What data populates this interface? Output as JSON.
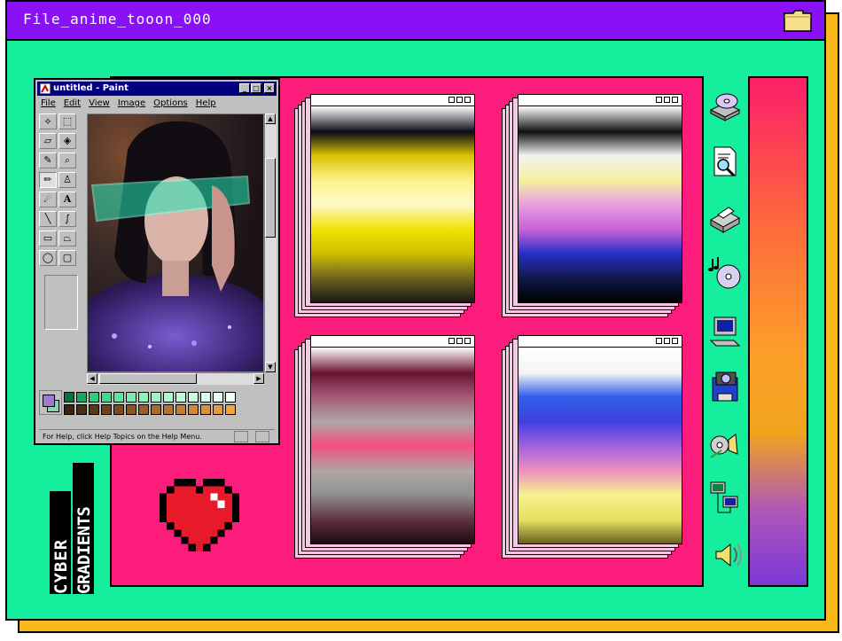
{
  "window": {
    "title": "File_anime_tooon_000",
    "folder_icon": "folder-icon"
  },
  "paint": {
    "title": "untitled - Paint",
    "menu": [
      "File",
      "Edit",
      "View",
      "Image",
      "Options",
      "Help"
    ],
    "status_text": "For Help, click Help Topics on the Help Menu.",
    "tools": [
      "free-select-icon",
      "rect-select-icon",
      "eraser-icon",
      "fill-icon",
      "picker-icon",
      "magnifier-icon",
      "pencil-icon",
      "brush-icon",
      "airbrush-icon",
      "text-icon",
      "line-icon",
      "curve-icon",
      "rectangle-icon",
      "polygon-icon",
      "ellipse-icon",
      "rounded-rect-icon"
    ],
    "palette_top": [
      "#0a6e3f",
      "#1aa860",
      "#2bc979",
      "#43d98c",
      "#5fe39f",
      "#7aebb0",
      "#90f0bd",
      "#a2f3c7",
      "#b1f6d0",
      "#bff8d8",
      "#cbfadf",
      "#d8fce7",
      "#e3fdee",
      "#eefef4"
    ],
    "palette_bottom": [
      "#3a2410",
      "#4a2e14",
      "#5a3818",
      "#6a421c",
      "#7a4c20",
      "#8a5624",
      "#986028",
      "#a66a2c",
      "#b47430",
      "#c27e34",
      "#ce8838",
      "#d8923c",
      "#e29c40",
      "#eca644"
    ]
  },
  "gradients": [
    {
      "stops": [
        "#ffffff",
        "#0c0a18",
        "#d7c200",
        "#fff38e",
        "#fff9c8",
        "#f0e200",
        "#cfc000",
        "#6c6020",
        "#1a1818"
      ]
    },
    {
      "stops": [
        "#ffffff",
        "#101010",
        "#f2f2f2",
        "#f4f0a0",
        "#e8a0e0",
        "#c860d8",
        "#2830c8",
        "#101848",
        "#000000"
      ]
    },
    {
      "stops": [
        "#ffffff",
        "#6a1232",
        "#a45a76",
        "#b0a6a6",
        "#f34d82",
        "#b0a6a6",
        "#909090",
        "#5e3240",
        "#1b0a12"
      ]
    },
    {
      "stops": [
        "#ffffff",
        "#f4f4f4",
        "#3060e8",
        "#4040e0",
        "#a060e0",
        "#f090c0",
        "#f6f090",
        "#e8e060",
        "#686020"
      ]
    }
  ],
  "colors": {
    "bg": "#15ee9c",
    "title": "#8811f5",
    "panel": "#fb1c7c",
    "shadow": "#f9b81b"
  },
  "desktop_icons": [
    "cd-drive-icon",
    "find-document-icon",
    "printer-icon",
    "music-cd-icon",
    "computer-icon",
    "camera-disk-icon",
    "sound-recorder-icon",
    "network-icon",
    "speaker-icon"
  ],
  "logo": {
    "line1": "CYBER",
    "line2": "GRADIENTS"
  }
}
